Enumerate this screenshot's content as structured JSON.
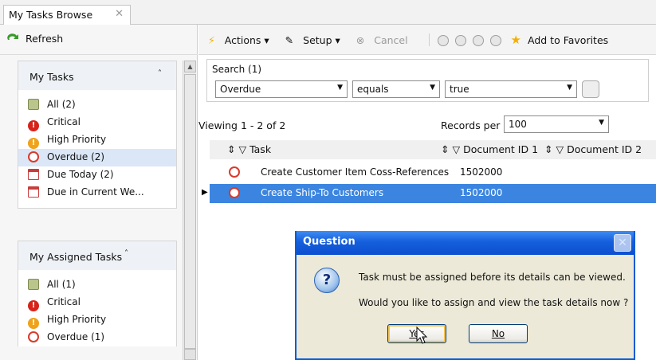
{
  "tab": {
    "title": "My Tasks Browse",
    "close": "✕"
  },
  "left": {
    "refresh_label": "Refresh",
    "my_tasks": {
      "title": "My Tasks",
      "caret": "˄",
      "items": [
        {
          "label": "All (2)",
          "icon": "clipboard-icon"
        },
        {
          "label": "Critical",
          "icon": "critical-icon"
        },
        {
          "label": "High Priority",
          "icon": "high-priority-icon"
        },
        {
          "label": "Overdue (2)",
          "icon": "alarm-clock-icon",
          "selected": true
        },
        {
          "label": "Due Today (2)",
          "icon": "calendar-icon"
        },
        {
          "label": "Due in Current We...",
          "icon": "calendar-icon"
        }
      ]
    },
    "assigned_tasks": {
      "title": "My Assigned Tasks",
      "caret": "˄",
      "items": [
        {
          "label": "All (1)",
          "icon": "clipboard-icon"
        },
        {
          "label": "Critical",
          "icon": "critical-icon"
        },
        {
          "label": "High Priority",
          "icon": "high-priority-icon"
        },
        {
          "label": "Overdue (1)",
          "icon": "alarm-clock-icon"
        }
      ]
    }
  },
  "toolbar": {
    "actions": "Actions ▾",
    "setup": "Setup ▾",
    "cancel": "Cancel",
    "favorites": "Add to Favorites"
  },
  "search": {
    "label": "Search (1)",
    "field": "Overdue",
    "operator": "equals",
    "value": "true"
  },
  "paging": {
    "viewing": "Viewing  1 - 2  of  2",
    "records_label": "Records per page:",
    "records_value": "100"
  },
  "grid": {
    "columns": [
      "Task",
      "Document ID 1",
      "Document ID 2"
    ],
    "rows": [
      {
        "task": "Create Customer Item Coss-References",
        "doc1": "1502000",
        "highlighted": false
      },
      {
        "task": "Create Ship-To Customers",
        "doc1": "1502000",
        "highlighted": true
      }
    ]
  },
  "dialog": {
    "title": "Question",
    "line1": "Task must be assigned before its details can be viewed.",
    "line2": "Would you like to assign and view the task details now ?",
    "yes_label": "Yes",
    "no_label": "No"
  }
}
